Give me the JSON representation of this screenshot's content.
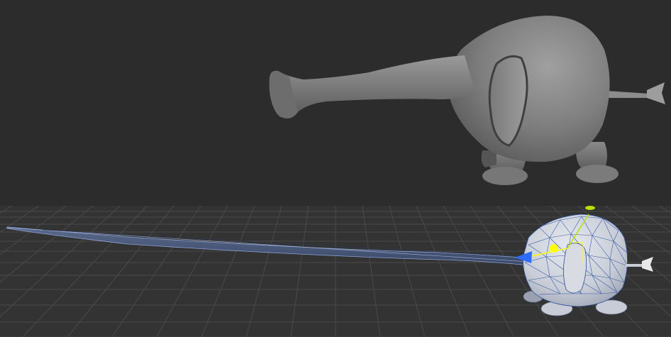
{
  "app": {
    "title": ""
  },
  "scene": {
    "top_view": {
      "mode": "shaded",
      "background_color": "#2c2c2c",
      "model": "elephant",
      "model_color": "#8a8a8a"
    },
    "bottom_view": {
      "mode": "wireframe-on-shaded",
      "background_color": "#333333",
      "grid": true,
      "grid_color": "#4a4a4a",
      "model": "elephant",
      "wire_color": "#2f4f9a",
      "manipulator_icons": [
        "move-x-arrow-icon",
        "move-y-handle-icon",
        "pivot-icon"
      ],
      "colors": {
        "x_axis": "#2e6bff",
        "y_axis": "#b8e000",
        "pivot": "#ffff00"
      }
    }
  }
}
